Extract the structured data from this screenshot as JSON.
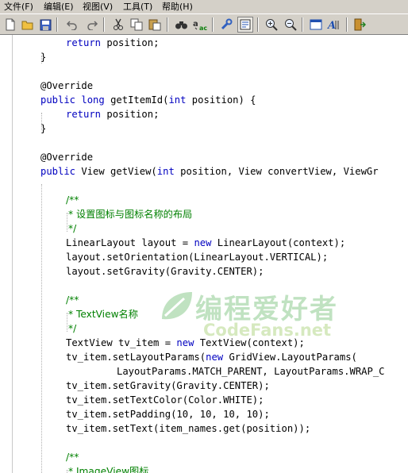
{
  "menu": {
    "file": "文件(F)",
    "edit": "编辑(E)",
    "view": "视图(V)",
    "tools": "工具(T)",
    "help": "帮助(H)"
  },
  "toolbar": {
    "buttons": [
      "new",
      "open",
      "save",
      "undo",
      "redo",
      "cut",
      "copy",
      "paste",
      "find",
      "replace",
      "tool",
      "properties",
      "zoom-in",
      "zoom-out",
      "view",
      "font",
      "exit"
    ]
  },
  "code": {
    "l1": {
      "t1": "return",
      "t2": " position;"
    },
    "l2": {
      "t1": "}"
    },
    "l3": {
      "t1": "@Override"
    },
    "l4": {
      "t1": "public",
      "t2": " ",
      "t3": "long",
      "t4": " getItemId(",
      "t5": "int",
      "t6": " position) {"
    },
    "l5": {
      "t1": "return",
      "t2": " position;"
    },
    "l6": {
      "t1": "}"
    },
    "l7": {
      "t1": "@Override"
    },
    "l8": {
      "t1": "public",
      "t2": " View getView(",
      "t3": "int",
      "t4": " position, View convertView, ViewGr"
    },
    "l9": {
      "t1": "/**"
    },
    "l10": {
      "t1": "* 设置图标与图标名称的布局"
    },
    "l11": {
      "t1": "*/"
    },
    "l12": {
      "t1": "LinearLayout layout = ",
      "t2": "new",
      "t3": " LinearLayout(context);"
    },
    "l13": {
      "t1": "layout.setOrientation(LinearLayout.VERTICAL);"
    },
    "l14": {
      "t1": "layout.setGravity(Gravity.CENTER);"
    },
    "l15": {
      "t1": "/**"
    },
    "l16": {
      "t1": "* TextView名称"
    },
    "l17": {
      "t1": "*/"
    },
    "l18": {
      "t1": "TextView tv_item = ",
      "t2": "new",
      "t3": " TextView(context);"
    },
    "l19": {
      "t1": "tv_item.setLayoutParams(",
      "t2": "new",
      "t3": " GridView.LayoutParams("
    },
    "l20": {
      "t1": "LayoutParams.MATCH_PARENT, LayoutParams.WRAP_C"
    },
    "l21": {
      "t1": "tv_item.setGravity(Gravity.CENTER);"
    },
    "l22": {
      "t1": "tv_item.setTextColor(Color.WHITE);"
    },
    "l23": {
      "t1": "tv_item.setPadding(10, 10, 10, 10);"
    },
    "l24": {
      "t1": "tv_item.setText(item_names.get(position));"
    },
    "l25": {
      "t1": "/**"
    },
    "l26": {
      "t1": "* ImageView图标"
    }
  },
  "watermark": {
    "title": "编程爱好者",
    "subtitle": "CodeFans.net"
  },
  "colors": {
    "keyword": "#0000c0",
    "comment": "#008000",
    "chrome": "#d4d0c8"
  }
}
